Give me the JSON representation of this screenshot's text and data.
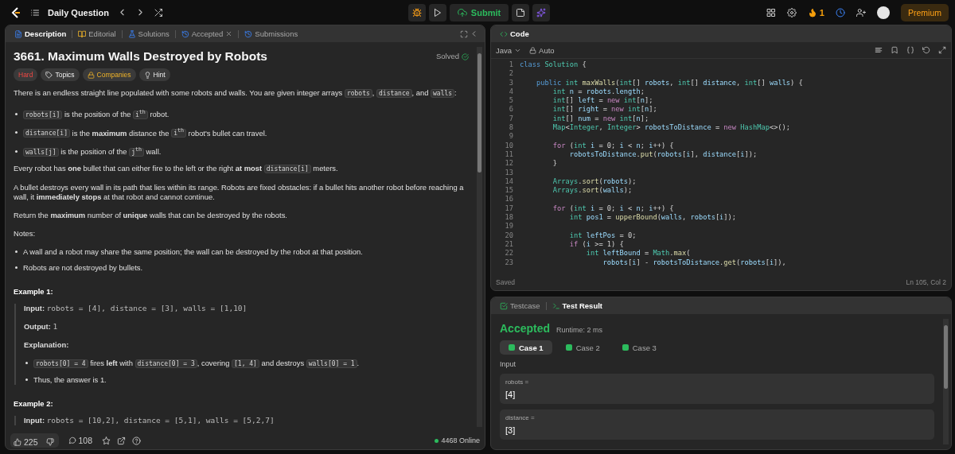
{
  "topbar": {
    "title": "Daily Question",
    "submit": "Submit",
    "streak": "1",
    "premium": "Premium"
  },
  "left_tabs": [
    {
      "label": "Description",
      "kind": "description",
      "selected": true
    },
    {
      "label": "Editorial",
      "kind": "editorial",
      "selected": false
    },
    {
      "label": "Solutions",
      "kind": "solutions",
      "selected": false
    },
    {
      "label": "Accepted",
      "kind": "accepted",
      "selected": false,
      "closable": true
    },
    {
      "label": "Submissions",
      "kind": "submissions",
      "selected": false
    }
  ],
  "description": {
    "title": "3661. Maximum Walls Destroyed by Robots",
    "status": "Solved",
    "tags": [
      {
        "label": "Hard",
        "kind": "difficulty"
      },
      {
        "label": "Topics",
        "kind": "topics"
      },
      {
        "label": "Companies",
        "kind": "companies"
      },
      {
        "label": "Hint",
        "kind": "hint"
      }
    ],
    "blocks": [
      {
        "kind": "para",
        "segments": [
          {
            "kind": "text",
            "text": "There is an endless straight line populated with some robots and walls. You are given integer arrays "
          },
          {
            "kind": "code",
            "text": "robots"
          },
          {
            "kind": "text",
            "text": ", "
          },
          {
            "kind": "code",
            "text": "distance"
          },
          {
            "kind": "text",
            "text": ", and "
          },
          {
            "kind": "code",
            "text": "walls"
          },
          {
            "kind": "text",
            "text": ":"
          }
        ]
      },
      {
        "kind": "bullet",
        "segments": [
          {
            "kind": "code",
            "text": "robots[i]"
          },
          {
            "kind": "text",
            "text": " is the position of the "
          },
          {
            "kind": "code",
            "text": "i$^{th}$"
          },
          {
            "kind": "text",
            "text": " robot."
          }
        ]
      },
      {
        "kind": "bullet",
        "segments": [
          {
            "kind": "code",
            "text": "distance[i]"
          },
          {
            "kind": "text",
            "text": " is the **maximum** distance the "
          },
          {
            "kind": "code",
            "text": "i$^{th}$"
          },
          {
            "kind": "text",
            "text": " robot's bullet can travel."
          }
        ]
      },
      {
        "kind": "bullet",
        "segments": [
          {
            "kind": "code",
            "text": "walls[j]"
          },
          {
            "kind": "text",
            "text": " is the position of the "
          },
          {
            "kind": "code",
            "text": "j$^{th}$"
          },
          {
            "kind": "text",
            "text": " wall."
          }
        ]
      },
      {
        "kind": "para",
        "segments": [
          {
            "kind": "text",
            "text": "Every robot has **one** bullet that can either fire to the left or the right **at most** "
          },
          {
            "kind": "code",
            "text": "distance[i]"
          },
          {
            "kind": "text",
            "text": " meters."
          }
        ]
      },
      {
        "kind": "para",
        "segments": [
          {
            "kind": "text",
            "text": "A bullet destroys every wall in its path that lies within its range. Robots are fixed obstacles: if a bullet hits another robot before reaching a wall, it **immediately stops** at that robot and cannot continue."
          }
        ]
      },
      {
        "kind": "para",
        "segments": [
          {
            "kind": "text",
            "text": "Return the **maximum** number of **unique** walls that can be destroyed by the robots."
          }
        ]
      },
      {
        "kind": "para",
        "segments": [
          {
            "kind": "text",
            "text": "Notes:"
          }
        ]
      },
      {
        "kind": "bullet",
        "segments": [
          {
            "kind": "text",
            "text": "A wall and a robot may share the same position; the wall can be destroyed by the robot at that position."
          }
        ]
      },
      {
        "kind": "bullet",
        "segments": [
          {
            "kind": "text",
            "text": "Robots are not destroyed by bullets."
          }
        ]
      },
      {
        "kind": "heading",
        "text": "Example 1:"
      },
      {
        "kind": "example",
        "lines": [
          {
            "kind": "field",
            "label": "Input:",
            "value": "robots = [4], distance = [3], walls = [1,10]"
          },
          {
            "kind": "field",
            "label": "Output:",
            "value": "1"
          },
          {
            "kind": "label",
            "label": "Explanation:"
          },
          {
            "kind": "bullet",
            "segments": [
              {
                "kind": "code",
                "text": "robots[0] = 4"
              },
              {
                "kind": "text",
                "text": " fires **left** with "
              },
              {
                "kind": "code",
                "text": "distance[0] = 3"
              },
              {
                "kind": "text",
                "text": ", covering "
              },
              {
                "kind": "code",
                "text": "[1, 4]"
              },
              {
                "kind": "text",
                "text": " and destroys "
              },
              {
                "kind": "code",
                "text": "walls[0] = 1"
              },
              {
                "kind": "text",
                "text": "."
              }
            ]
          },
          {
            "kind": "bullet",
            "segments": [
              {
                "kind": "text",
                "text": "Thus, the answer is 1."
              }
            ]
          }
        ]
      },
      {
        "kind": "heading",
        "text": "Example 2:"
      },
      {
        "kind": "example",
        "lines": [
          {
            "kind": "field",
            "label": "Input:",
            "value": "robots = [10,2], distance = [5,1], walls = [5,2,7]"
          }
        ]
      }
    ]
  },
  "left_footer": {
    "likes": "225",
    "comments": "108",
    "online": "4468 Online"
  },
  "code_panel": {
    "title": "Code",
    "language": "Java",
    "mode": "Auto",
    "saved": "Saved",
    "cursor": "Ln 105, Col 2",
    "lines": [
      {
        "num": "1",
        "tokens": [
          {
            "kind": "kw",
            "text": "class "
          },
          {
            "kind": "type",
            "text": "Solution"
          },
          {
            "kind": "p",
            "text": " {"
          }
        ]
      },
      {
        "num": "2"
      },
      {
        "num": "3",
        "tokens": [
          {
            "kind": "kw",
            "text": "    public "
          },
          {
            "kind": "type",
            "text": "int "
          },
          {
            "kind": "fn",
            "text": "maxWalls"
          },
          {
            "kind": "p",
            "text": "("
          },
          {
            "kind": "type",
            "text": "int"
          },
          {
            "kind": "p",
            "text": "[] "
          },
          {
            "kind": "var",
            "text": "robots"
          },
          {
            "kind": "p",
            "text": ", "
          },
          {
            "kind": "type",
            "text": "int"
          },
          {
            "kind": "p",
            "text": "[] "
          },
          {
            "kind": "var",
            "text": "distance"
          },
          {
            "kind": "p",
            "text": ", "
          },
          {
            "kind": "type",
            "text": "int"
          },
          {
            "kind": "p",
            "text": "[] "
          },
          {
            "kind": "var",
            "text": "walls"
          },
          {
            "kind": "p",
            "text": ") {"
          }
        ]
      },
      {
        "num": "4",
        "tokens": [
          {
            "kind": "type",
            "text": "        int "
          },
          {
            "kind": "var",
            "text": "n"
          },
          {
            "kind": "p",
            "text": " = "
          },
          {
            "kind": "var",
            "text": "robots"
          },
          {
            "kind": "p",
            "text": "."
          },
          {
            "kind": "var",
            "text": "length"
          },
          {
            "kind": "p",
            "text": ";"
          }
        ]
      },
      {
        "num": "5",
        "tokens": [
          {
            "kind": "type",
            "text": "        int"
          },
          {
            "kind": "p",
            "text": "[] "
          },
          {
            "kind": "var",
            "text": "left"
          },
          {
            "kind": "p",
            "text": " = "
          },
          {
            "kind": "ctl",
            "text": "new "
          },
          {
            "kind": "type",
            "text": "int"
          },
          {
            "kind": "p",
            "text": "["
          },
          {
            "kind": "var",
            "text": "n"
          },
          {
            "kind": "p",
            "text": "];"
          }
        ]
      },
      {
        "num": "6",
        "tokens": [
          {
            "kind": "type",
            "text": "        int"
          },
          {
            "kind": "p",
            "text": "[] "
          },
          {
            "kind": "var",
            "text": "right"
          },
          {
            "kind": "p",
            "text": " = "
          },
          {
            "kind": "ctl",
            "text": "new "
          },
          {
            "kind": "type",
            "text": "int"
          },
          {
            "kind": "p",
            "text": "["
          },
          {
            "kind": "var",
            "text": "n"
          },
          {
            "kind": "p",
            "text": "];"
          }
        ]
      },
      {
        "num": "7",
        "tokens": [
          {
            "kind": "type",
            "text": "        int"
          },
          {
            "kind": "p",
            "text": "[] "
          },
          {
            "kind": "var",
            "text": "num"
          },
          {
            "kind": "p",
            "text": " = "
          },
          {
            "kind": "ctl",
            "text": "new "
          },
          {
            "kind": "type",
            "text": "int"
          },
          {
            "kind": "p",
            "text": "["
          },
          {
            "kind": "var",
            "text": "n"
          },
          {
            "kind": "p",
            "text": "];"
          }
        ]
      },
      {
        "num": "8",
        "tokens": [
          {
            "kind": "type",
            "text": "        Map"
          },
          {
            "kind": "p",
            "text": "<"
          },
          {
            "kind": "type",
            "text": "Integer"
          },
          {
            "kind": "p",
            "text": ", "
          },
          {
            "kind": "type",
            "text": "Integer"
          },
          {
            "kind": "p",
            "text": "> "
          },
          {
            "kind": "var",
            "text": "robotsToDistance"
          },
          {
            "kind": "p",
            "text": " = "
          },
          {
            "kind": "ctl",
            "text": "new "
          },
          {
            "kind": "type",
            "text": "HashMap"
          },
          {
            "kind": "p",
            "text": "<>();"
          }
        ]
      },
      {
        "num": "9"
      },
      {
        "num": "10",
        "tokens": [
          {
            "kind": "ctl",
            "text": "        for"
          },
          {
            "kind": "p",
            "text": " ("
          },
          {
            "kind": "type",
            "text": "int "
          },
          {
            "kind": "var",
            "text": "i"
          },
          {
            "kind": "p",
            "text": " = 0; "
          },
          {
            "kind": "var",
            "text": "i"
          },
          {
            "kind": "p",
            "text": " < "
          },
          {
            "kind": "var",
            "text": "n"
          },
          {
            "kind": "p",
            "text": "; "
          },
          {
            "kind": "var",
            "text": "i"
          },
          {
            "kind": "p",
            "text": "++) {"
          }
        ]
      },
      {
        "num": "11",
        "tokens": [
          {
            "kind": "var",
            "text": "            robotsToDistance"
          },
          {
            "kind": "p",
            "text": "."
          },
          {
            "kind": "fn",
            "text": "put"
          },
          {
            "kind": "p",
            "text": "("
          },
          {
            "kind": "var",
            "text": "robots"
          },
          {
            "kind": "p",
            "text": "["
          },
          {
            "kind": "var",
            "text": "i"
          },
          {
            "kind": "p",
            "text": "], "
          },
          {
            "kind": "var",
            "text": "distance"
          },
          {
            "kind": "p",
            "text": "["
          },
          {
            "kind": "var",
            "text": "i"
          },
          {
            "kind": "p",
            "text": "]);"
          }
        ]
      },
      {
        "num": "12",
        "tokens": [
          {
            "kind": "p",
            "text": "        }"
          }
        ]
      },
      {
        "num": "13"
      },
      {
        "num": "14",
        "tokens": [
          {
            "kind": "type",
            "text": "        Arrays"
          },
          {
            "kind": "p",
            "text": "."
          },
          {
            "kind": "fn",
            "text": "sort"
          },
          {
            "kind": "p",
            "text": "("
          },
          {
            "kind": "var",
            "text": "robots"
          },
          {
            "kind": "p",
            "text": ");"
          }
        ]
      },
      {
        "num": "15",
        "tokens": [
          {
            "kind": "type",
            "text": "        Arrays"
          },
          {
            "kind": "p",
            "text": "."
          },
          {
            "kind": "fn",
            "text": "sort"
          },
          {
            "kind": "p",
            "text": "("
          },
          {
            "kind": "var",
            "text": "walls"
          },
          {
            "kind": "p",
            "text": ");"
          }
        ]
      },
      {
        "num": "16"
      },
      {
        "num": "17",
        "tokens": [
          {
            "kind": "ctl",
            "text": "        for"
          },
          {
            "kind": "p",
            "text": " ("
          },
          {
            "kind": "type",
            "text": "int "
          },
          {
            "kind": "var",
            "text": "i"
          },
          {
            "kind": "p",
            "text": " = 0; "
          },
          {
            "kind": "var",
            "text": "i"
          },
          {
            "kind": "p",
            "text": " < "
          },
          {
            "kind": "var",
            "text": "n"
          },
          {
            "kind": "p",
            "text": "; "
          },
          {
            "kind": "var",
            "text": "i"
          },
          {
            "kind": "p",
            "text": "++) {"
          }
        ]
      },
      {
        "num": "18",
        "tokens": [
          {
            "kind": "type",
            "text": "            int "
          },
          {
            "kind": "var",
            "text": "pos1"
          },
          {
            "kind": "p",
            "text": " = "
          },
          {
            "kind": "fn",
            "text": "upperBound"
          },
          {
            "kind": "p",
            "text": "("
          },
          {
            "kind": "var",
            "text": "walls"
          },
          {
            "kind": "p",
            "text": ", "
          },
          {
            "kind": "var",
            "text": "robots"
          },
          {
            "kind": "p",
            "text": "["
          },
          {
            "kind": "var",
            "text": "i"
          },
          {
            "kind": "p",
            "text": "]);"
          }
        ]
      },
      {
        "num": "19"
      },
      {
        "num": "20",
        "tokens": [
          {
            "kind": "type",
            "text": "            int "
          },
          {
            "kind": "var",
            "text": "leftPos"
          },
          {
            "kind": "p",
            "text": " = 0;"
          }
        ]
      },
      {
        "num": "21",
        "tokens": [
          {
            "kind": "ctl",
            "text": "            if"
          },
          {
            "kind": "p",
            "text": " ("
          },
          {
            "kind": "var",
            "text": "i"
          },
          {
            "kind": "p",
            "text": " >= 1) {"
          }
        ]
      },
      {
        "num": "22",
        "tokens": [
          {
            "kind": "type",
            "text": "                int "
          },
          {
            "kind": "var",
            "text": "leftBound"
          },
          {
            "kind": "p",
            "text": " = "
          },
          {
            "kind": "type",
            "text": "Math"
          },
          {
            "kind": "p",
            "text": "."
          },
          {
            "kind": "fn",
            "text": "max"
          },
          {
            "kind": "p",
            "text": "("
          }
        ]
      },
      {
        "num": "23",
        "tokens": [
          {
            "kind": "var",
            "text": "                    robots"
          },
          {
            "kind": "p",
            "text": "["
          },
          {
            "kind": "var",
            "text": "i"
          },
          {
            "kind": "p",
            "text": "] - "
          },
          {
            "kind": "var",
            "text": "robotsToDistance"
          },
          {
            "kind": "p",
            "text": "."
          },
          {
            "kind": "fn",
            "text": "get"
          },
          {
            "kind": "p",
            "text": "("
          },
          {
            "kind": "var",
            "text": "robots"
          },
          {
            "kind": "p",
            "text": "["
          },
          {
            "kind": "var",
            "text": "i"
          },
          {
            "kind": "p",
            "text": "]),"
          }
        ]
      }
    ]
  },
  "test_panel": {
    "tabs": [
      {
        "label": "Testcase",
        "kind": "testcase",
        "selected": false
      },
      {
        "label": "Test Result",
        "kind": "result",
        "selected": true
      }
    ],
    "verdict": "Accepted",
    "runtime": "Runtime: 2 ms",
    "cases": [
      {
        "label": "Case 1",
        "selected": true,
        "passed": true
      },
      {
        "label": "Case 2",
        "selected": false,
        "passed": true
      },
      {
        "label": "Case 3",
        "selected": false,
        "passed": true
      }
    ],
    "input_label": "Input",
    "inputs": [
      {
        "name": "robots =",
        "value": "[4]"
      },
      {
        "name": "distance =",
        "value": "[3]"
      }
    ]
  }
}
